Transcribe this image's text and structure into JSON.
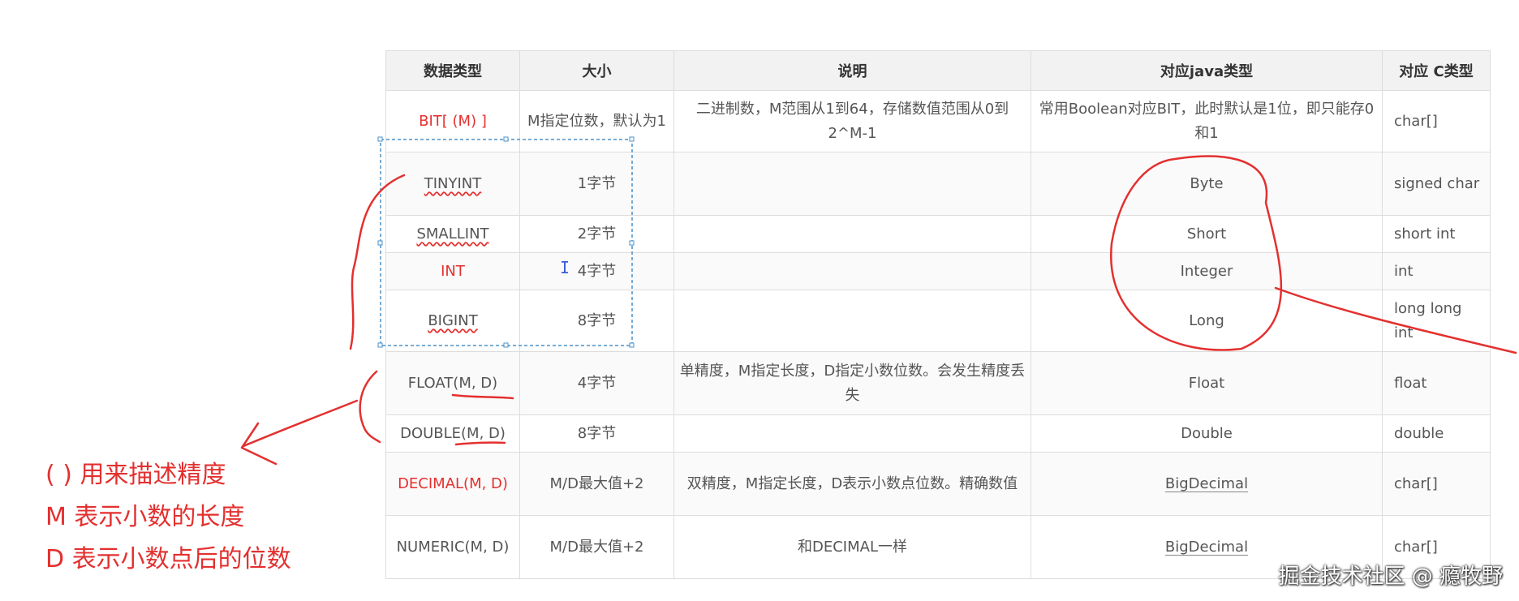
{
  "table": {
    "headers": [
      "数据类型",
      "大小",
      "说明",
      "对应java类型",
      "对应 C类型"
    ],
    "rows": [
      {
        "type": "BIT[ (M) ]",
        "size": "M指定位数，默认为1",
        "desc": "二进制数，M范围从1到64，存储数值范围从0到2^M-1",
        "java": "常用Boolean对应BIT，此时默认是1位，即只能存0和1",
        "c": "char[]"
      },
      {
        "type": "TINYINT",
        "size": "1字节",
        "desc": "",
        "java": "Byte",
        "c": "signed char"
      },
      {
        "type": "SMALLINT",
        "size": "2字节",
        "desc": "",
        "java": "Short",
        "c": "short int"
      },
      {
        "type": "INT",
        "size": "4字节",
        "desc": "",
        "java": "Integer",
        "c": "int"
      },
      {
        "type": "BIGINT",
        "size": "8字节",
        "desc": "",
        "java": "Long",
        "c": "long long int"
      },
      {
        "type": "FLOAT(M, D)",
        "size": "4字节",
        "desc": "单精度，M指定长度，D指定小数位数。会发生精度丢失",
        "java": "Float",
        "c": "float"
      },
      {
        "type": "DOUBLE(M, D)",
        "size": "8字节",
        "desc": "",
        "java": "Double",
        "c": "double"
      },
      {
        "type": "DECIMAL(M, D)",
        "size": "M/D最大值+2",
        "desc": "双精度，M指定长度，D表示小数点位数。精确数值",
        "java": "BigDecimal",
        "c": "char[]"
      },
      {
        "type": "NUMERIC(M, D)",
        "size": "M/D最大值+2",
        "desc": "和DECIMAL一样",
        "java": "BigDecimal",
        "c": "char[]"
      }
    ]
  },
  "notes": {
    "line1": "( ) 用来描述精度",
    "line2": "M 表示小数的长度",
    "line3": "D 表示小数点后的位数"
  },
  "watermark": "掘金技术社区 @ 瘾牧野",
  "colors": {
    "annotation_red": "#e3302f",
    "header_bg": "#f2f2f2",
    "border": "#dddddd",
    "selection_blue": "#4a90c8"
  },
  "icons": {
    "cursor": "text-cursor-icon"
  }
}
